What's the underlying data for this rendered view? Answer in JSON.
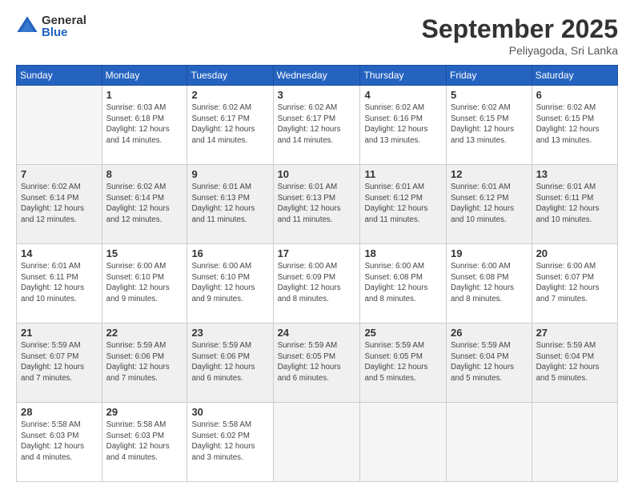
{
  "logo": {
    "general": "General",
    "blue": "Blue"
  },
  "title": "September 2025",
  "location": "Peliyagoda, Sri Lanka",
  "headers": [
    "Sunday",
    "Monday",
    "Tuesday",
    "Wednesday",
    "Thursday",
    "Friday",
    "Saturday"
  ],
  "weeks": [
    {
      "shaded": false,
      "days": [
        {
          "num": "",
          "info": ""
        },
        {
          "num": "1",
          "info": "Sunrise: 6:03 AM\nSunset: 6:18 PM\nDaylight: 12 hours\nand 14 minutes."
        },
        {
          "num": "2",
          "info": "Sunrise: 6:02 AM\nSunset: 6:17 PM\nDaylight: 12 hours\nand 14 minutes."
        },
        {
          "num": "3",
          "info": "Sunrise: 6:02 AM\nSunset: 6:17 PM\nDaylight: 12 hours\nand 14 minutes."
        },
        {
          "num": "4",
          "info": "Sunrise: 6:02 AM\nSunset: 6:16 PM\nDaylight: 12 hours\nand 13 minutes."
        },
        {
          "num": "5",
          "info": "Sunrise: 6:02 AM\nSunset: 6:15 PM\nDaylight: 12 hours\nand 13 minutes."
        },
        {
          "num": "6",
          "info": "Sunrise: 6:02 AM\nSunset: 6:15 PM\nDaylight: 12 hours\nand 13 minutes."
        }
      ]
    },
    {
      "shaded": true,
      "days": [
        {
          "num": "7",
          "info": "Sunrise: 6:02 AM\nSunset: 6:14 PM\nDaylight: 12 hours\nand 12 minutes."
        },
        {
          "num": "8",
          "info": "Sunrise: 6:02 AM\nSunset: 6:14 PM\nDaylight: 12 hours\nand 12 minutes."
        },
        {
          "num": "9",
          "info": "Sunrise: 6:01 AM\nSunset: 6:13 PM\nDaylight: 12 hours\nand 11 minutes."
        },
        {
          "num": "10",
          "info": "Sunrise: 6:01 AM\nSunset: 6:13 PM\nDaylight: 12 hours\nand 11 minutes."
        },
        {
          "num": "11",
          "info": "Sunrise: 6:01 AM\nSunset: 6:12 PM\nDaylight: 12 hours\nand 11 minutes."
        },
        {
          "num": "12",
          "info": "Sunrise: 6:01 AM\nSunset: 6:12 PM\nDaylight: 12 hours\nand 10 minutes."
        },
        {
          "num": "13",
          "info": "Sunrise: 6:01 AM\nSunset: 6:11 PM\nDaylight: 12 hours\nand 10 minutes."
        }
      ]
    },
    {
      "shaded": false,
      "days": [
        {
          "num": "14",
          "info": "Sunrise: 6:01 AM\nSunset: 6:11 PM\nDaylight: 12 hours\nand 10 minutes."
        },
        {
          "num": "15",
          "info": "Sunrise: 6:00 AM\nSunset: 6:10 PM\nDaylight: 12 hours\nand 9 minutes."
        },
        {
          "num": "16",
          "info": "Sunrise: 6:00 AM\nSunset: 6:10 PM\nDaylight: 12 hours\nand 9 minutes."
        },
        {
          "num": "17",
          "info": "Sunrise: 6:00 AM\nSunset: 6:09 PM\nDaylight: 12 hours\nand 8 minutes."
        },
        {
          "num": "18",
          "info": "Sunrise: 6:00 AM\nSunset: 6:08 PM\nDaylight: 12 hours\nand 8 minutes."
        },
        {
          "num": "19",
          "info": "Sunrise: 6:00 AM\nSunset: 6:08 PM\nDaylight: 12 hours\nand 8 minutes."
        },
        {
          "num": "20",
          "info": "Sunrise: 6:00 AM\nSunset: 6:07 PM\nDaylight: 12 hours\nand 7 minutes."
        }
      ]
    },
    {
      "shaded": true,
      "days": [
        {
          "num": "21",
          "info": "Sunrise: 5:59 AM\nSunset: 6:07 PM\nDaylight: 12 hours\nand 7 minutes."
        },
        {
          "num": "22",
          "info": "Sunrise: 5:59 AM\nSunset: 6:06 PM\nDaylight: 12 hours\nand 7 minutes."
        },
        {
          "num": "23",
          "info": "Sunrise: 5:59 AM\nSunset: 6:06 PM\nDaylight: 12 hours\nand 6 minutes."
        },
        {
          "num": "24",
          "info": "Sunrise: 5:59 AM\nSunset: 6:05 PM\nDaylight: 12 hours\nand 6 minutes."
        },
        {
          "num": "25",
          "info": "Sunrise: 5:59 AM\nSunset: 6:05 PM\nDaylight: 12 hours\nand 5 minutes."
        },
        {
          "num": "26",
          "info": "Sunrise: 5:59 AM\nSunset: 6:04 PM\nDaylight: 12 hours\nand 5 minutes."
        },
        {
          "num": "27",
          "info": "Sunrise: 5:59 AM\nSunset: 6:04 PM\nDaylight: 12 hours\nand 5 minutes."
        }
      ]
    },
    {
      "shaded": false,
      "days": [
        {
          "num": "28",
          "info": "Sunrise: 5:58 AM\nSunset: 6:03 PM\nDaylight: 12 hours\nand 4 minutes."
        },
        {
          "num": "29",
          "info": "Sunrise: 5:58 AM\nSunset: 6:03 PM\nDaylight: 12 hours\nand 4 minutes."
        },
        {
          "num": "30",
          "info": "Sunrise: 5:58 AM\nSunset: 6:02 PM\nDaylight: 12 hours\nand 3 minutes."
        },
        {
          "num": "",
          "info": ""
        },
        {
          "num": "",
          "info": ""
        },
        {
          "num": "",
          "info": ""
        },
        {
          "num": "",
          "info": ""
        }
      ]
    }
  ]
}
